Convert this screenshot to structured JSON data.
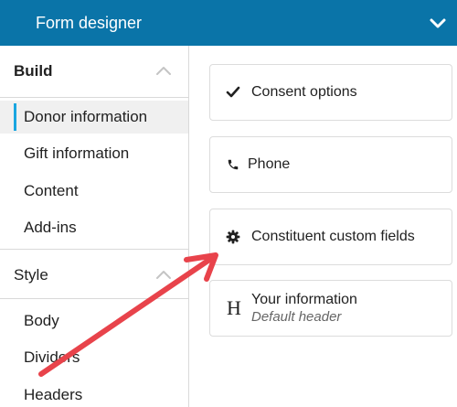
{
  "header": {
    "title": "Form designer",
    "collapse_icon": "chevron-down-icon",
    "background_color": "#0a74a8"
  },
  "left_panel": {
    "build": {
      "label": "Build",
      "collapse_icon": "chevron-up-icon",
      "items": [
        {
          "label": "Donor information",
          "active": true
        },
        {
          "label": "Gift information",
          "active": false
        },
        {
          "label": "Content",
          "active": false
        },
        {
          "label": "Add-ins",
          "active": false
        }
      ]
    },
    "style": {
      "label": "Style",
      "collapse_icon": "chevron-up-icon",
      "items": [
        {
          "label": "Body"
        },
        {
          "label": "Dividers"
        },
        {
          "label": "Headers"
        }
      ]
    },
    "active_indicator_color": "#1aa6e0"
  },
  "right_panel": {
    "cards": [
      {
        "icon": "checkmark-icon",
        "label": "Consent options"
      },
      {
        "icon": "phone-icon",
        "label": "Phone"
      },
      {
        "icon": "gear-icon",
        "label": "Constituent custom fields"
      },
      {
        "icon": "header-h-icon",
        "icon_glyph": "H",
        "label": "Your information",
        "sublabel": "Default header"
      }
    ]
  },
  "annotation": {
    "icon": "red-arrow-icon",
    "color": "#e8434b"
  }
}
